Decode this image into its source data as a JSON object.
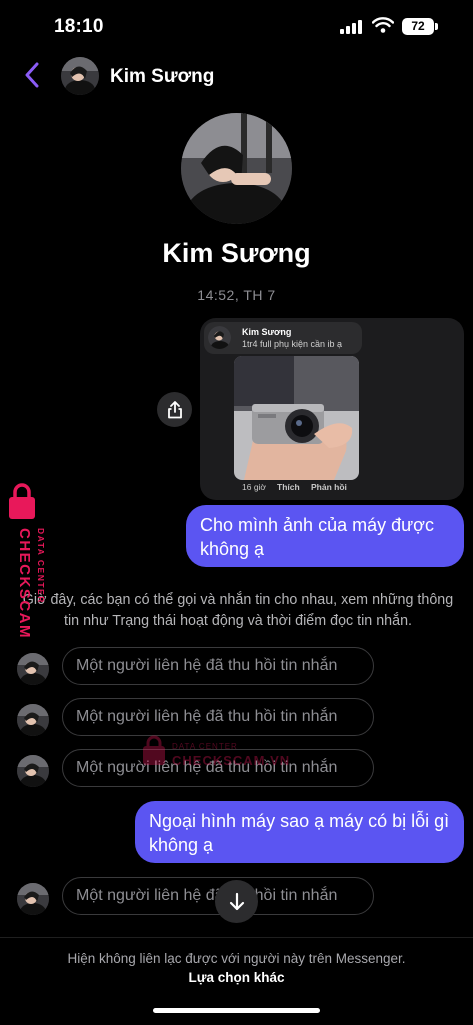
{
  "status_bar": {
    "time": "18:10",
    "battery": "72"
  },
  "header": {
    "name": "Kim Sương"
  },
  "profile": {
    "name": "Kim Sương",
    "timestamp": "14:52, TH 7"
  },
  "shared_post": {
    "author": "Kim Sương",
    "caption": "1tr4 full phụ kiện cần ib ạ",
    "age": "16 giờ",
    "like_label": "Thích",
    "reply_label": "Phản hồi"
  },
  "messages": {
    "outgoing_1": "Cho mình ảnh của máy được không ạ",
    "info_notice": "Giờ đây, các bạn có thể gọi và nhắn tin cho nhau, xem những thông tin như Trạng thái hoạt động và thời điểm đọc tin nhắn.",
    "recalled_1": "Một người liên hệ đã thu hồi tin nhắn",
    "recalled_2": "Một người liên hệ đã thu hồi tin nhắn",
    "recalled_3": "Một người liên hệ đã thu hồi tin nhắn",
    "outgoing_2": "Ngoại hình máy sao ạ máy có bị lỗi gì không ạ",
    "recalled_4": "Một người liên hệ đã thu hồi tin nhắn"
  },
  "footer": {
    "notice": "Hiện không liên lạc được với người này trên Messenger.",
    "link": "Lựa chọn khác"
  },
  "watermark": {
    "brand": "CHECKSCAM.VN",
    "tagline": "DATA CENTER"
  },
  "colors": {
    "bubble": "#5b55f2",
    "accent": "#8b5cf6",
    "watermark": "#e8185a"
  },
  "icons": [
    "back-chevron-icon",
    "share-icon",
    "arrow-down-icon",
    "wifi-icon",
    "signal-icon",
    "battery-icon",
    "lock-icon"
  ]
}
